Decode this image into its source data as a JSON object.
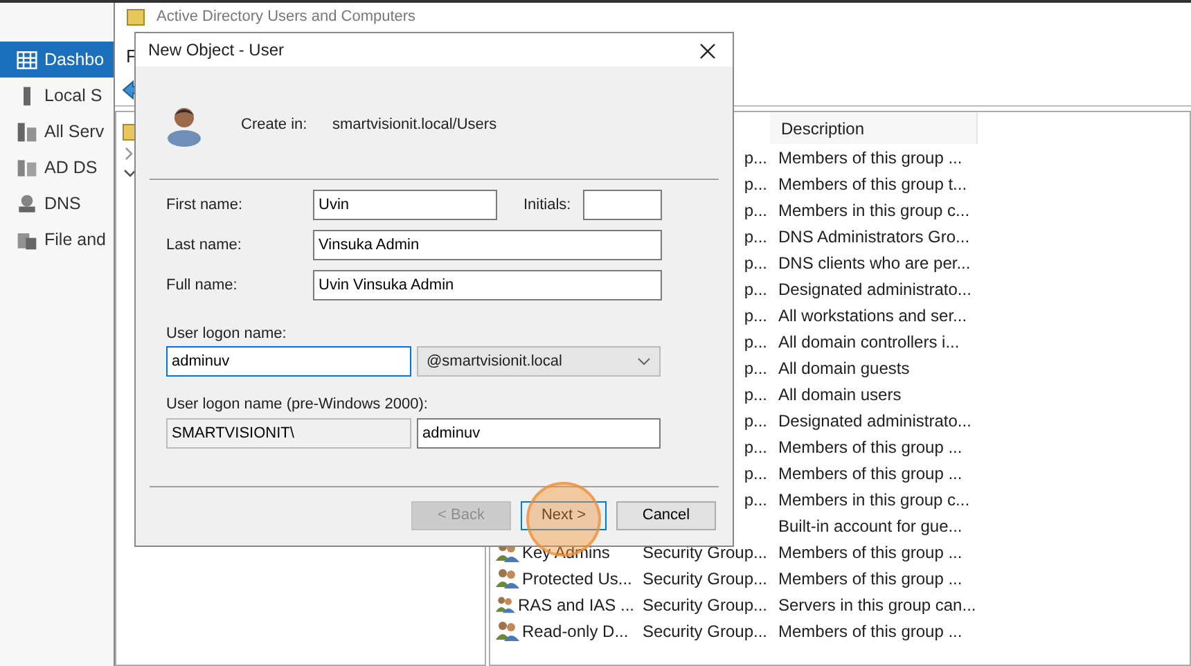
{
  "sidebar": {
    "items": [
      {
        "label": "Dashbo",
        "selected": true
      },
      {
        "label": "Local S",
        "selected": false
      },
      {
        "label": "All Serv",
        "selected": false
      },
      {
        "label": "AD DS",
        "selected": false
      },
      {
        "label": "DNS",
        "selected": false
      },
      {
        "label": "File and",
        "selected": false
      }
    ]
  },
  "aduc_window": {
    "title": "Active Directory Users and Computers",
    "menu": [
      "F"
    ],
    "list": {
      "columns": [
        "Description"
      ],
      "rows": [
        {
          "type": "p...",
          "description": "Members of this group ..."
        },
        {
          "type": "p...",
          "description": "Members of this group t..."
        },
        {
          "type": "p...",
          "description": "Members in this group c..."
        },
        {
          "type": "p...",
          "description": "DNS Administrators Gro..."
        },
        {
          "type": "p...",
          "description": "DNS clients who are per..."
        },
        {
          "type": "p...",
          "description": "Designated administrato..."
        },
        {
          "type": "p...",
          "description": "All workstations and ser..."
        },
        {
          "type": "p...",
          "description": "All domain controllers i..."
        },
        {
          "type": "p...",
          "description": "All domain guests"
        },
        {
          "type": "p...",
          "description": "All domain users"
        },
        {
          "type": "p...",
          "description": "Designated administrato..."
        },
        {
          "type": "p...",
          "description": "Members of this group ..."
        },
        {
          "type": "p...",
          "description": "Members of this group ..."
        },
        {
          "type": "p...",
          "description": "Members in this group c..."
        },
        {
          "description": "Built-in account for gue..."
        },
        {
          "name": "Key Admins",
          "type": "Security Group...",
          "description": "Members of this group ..."
        },
        {
          "name": "Protected Us...",
          "type": "Security Group...",
          "description": "Members of this group ..."
        },
        {
          "name": "RAS and IAS ...",
          "type": "Security Group...",
          "description": "Servers in this group can..."
        },
        {
          "name": "Read-only D...",
          "type": "Security Group...",
          "description": "Members of this group ..."
        }
      ]
    }
  },
  "dialog": {
    "title": "New Object - User",
    "create_in_label": "Create in:",
    "create_in_path": "smartvisionit.local/Users",
    "name_fields": [
      {
        "label": "First name:",
        "value": "Uvin"
      },
      {
        "label": "Last name:",
        "value": "Vinsuka Admin"
      },
      {
        "label": "Full name:",
        "value": "Uvin Vinsuka Admin"
      }
    ],
    "initials": {
      "label": "Initials:"
    },
    "logon": {
      "label": "User logon name:",
      "value": "adminuv",
      "focused": true,
      "domain": "@smartvisionit.local"
    },
    "pre2000": {
      "label": "User logon name (pre-Windows 2000):",
      "domain": "SMARTVISIONIT\\",
      "value": "adminuv"
    },
    "buttons": [
      {
        "label": "< Back",
        "disabled": true,
        "default": false,
        "highlighted": false
      },
      {
        "label": "Next >",
        "disabled": false,
        "default": true,
        "highlighted": true
      },
      {
        "label": "Cancel",
        "disabled": false,
        "default": false,
        "highlighted": false
      }
    ]
  }
}
